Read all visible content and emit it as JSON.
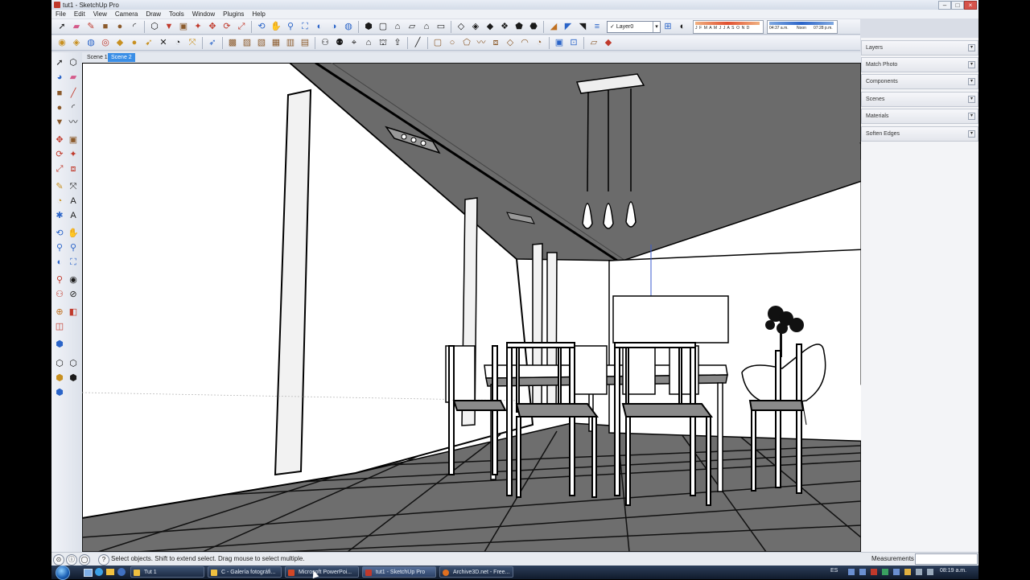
{
  "window": {
    "title": "tut1 - SketchUp Pro"
  },
  "menu": [
    "File",
    "Edit",
    "View",
    "Camera",
    "Draw",
    "Tools",
    "Window",
    "Plugins",
    "Help"
  ],
  "toolbar": {
    "layer_selected": "Layer0",
    "shadow_months": "J F M A M J J A S O N D",
    "shadow_time_start": "04:37 a.m.",
    "shadow_time_mid": "Noon",
    "shadow_time_end": "07:28 p.m."
  },
  "scenes": [
    "Scene 1",
    "Scene 2"
  ],
  "panels": [
    "Layers",
    "Match Photo",
    "Components",
    "Scenes",
    "Materials",
    "Soften Edges"
  ],
  "status": {
    "hint": "Select objects. Shift to extend select. Drag mouse to select multiple.",
    "measurements_label": "Measurements"
  },
  "taskbar": {
    "tasks": [
      "Tut 1",
      "C - Galería fotográfi...",
      "Microsoft PowerPoi...",
      "tut1 - SketchUp Pro",
      "Archive3D.net - Free..."
    ],
    "lang": "ES",
    "clock": "08:19 a.m."
  }
}
